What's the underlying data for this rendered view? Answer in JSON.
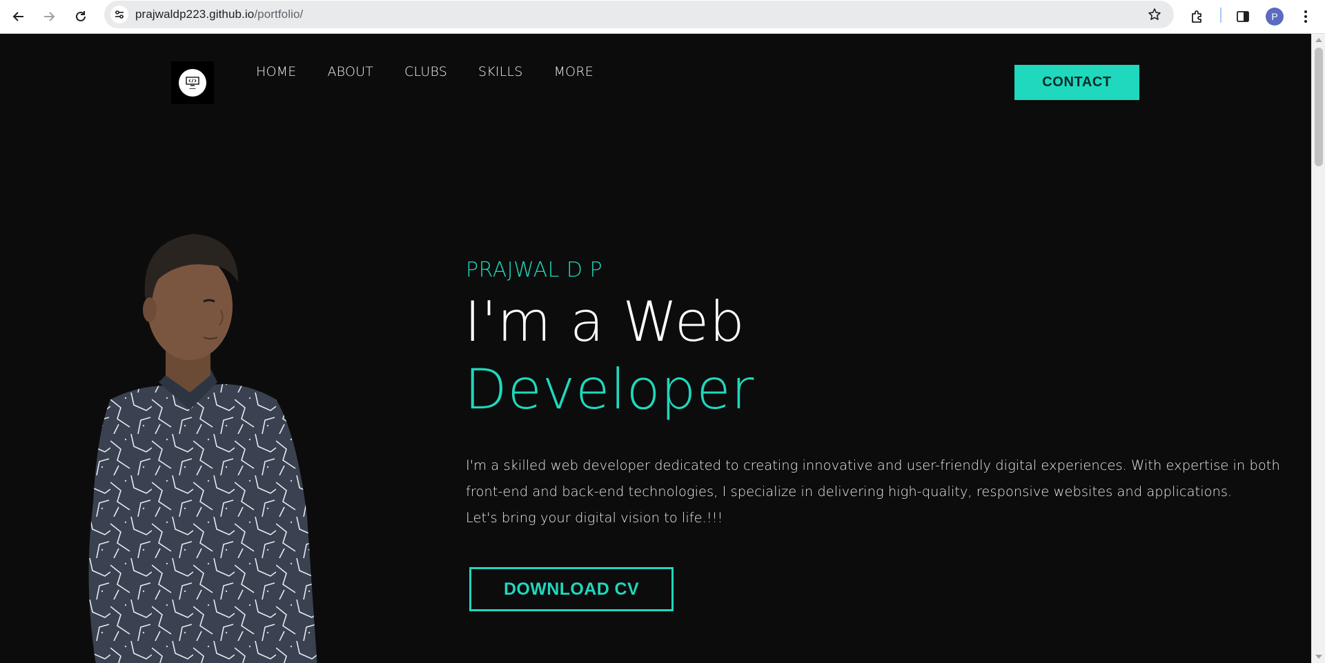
{
  "browser": {
    "url_host": "prajwaldp223.github.io",
    "url_path": "/portfolio/",
    "profile_initial": "P",
    "icons": [
      "back-arrow-icon",
      "forward-arrow-icon",
      "reload-icon",
      "site-settings-icon",
      "bookmark-star-icon",
      "extensions-icon",
      "side-panel-icon",
      "more-vert-icon"
    ]
  },
  "site": {
    "nav": [
      "HOME",
      "ABOUT",
      "CLUBS",
      "SKILLS",
      "MORE"
    ],
    "contact_label": "CONTACT",
    "accent_color": "#1fd8bd",
    "background_color": "#0c0c0c"
  },
  "hero": {
    "name": "PRAJWAL D P",
    "headline_1": "I'm a Web",
    "headline_2": "Developer",
    "bio_lines": [
      "I'm a skilled web developer dedicated to creating innovative and user-friendly digital experiences. With expertise in both",
      "front-end and back-end technologies, I specialize in delivering high-quality, responsive websites and applications.",
      "Let's bring your digital vision to life.!!!"
    ],
    "download_label": "DOWNLOAD CV"
  }
}
